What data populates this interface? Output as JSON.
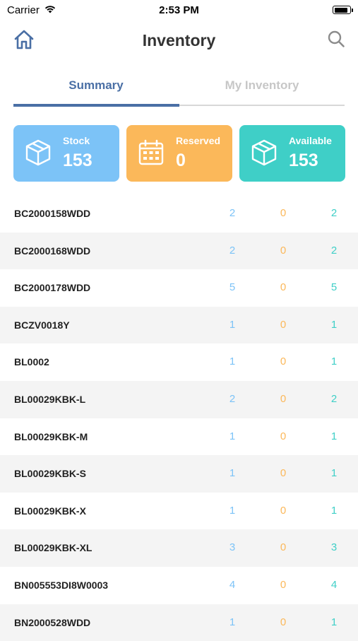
{
  "status_bar": {
    "carrier": "Carrier",
    "time": "2:53 PM",
    "battery_level": 0.9
  },
  "header": {
    "title": "Inventory",
    "left_icon": "home-icon",
    "right_icon": "search-icon"
  },
  "tabs": [
    {
      "label": "Summary",
      "active": true
    },
    {
      "label": "My Inventory",
      "active": false
    }
  ],
  "summary_cards": [
    {
      "label": "Stock",
      "value": "153",
      "icon": "box-icon",
      "color": "#7cc3f7"
    },
    {
      "label": "Reserved",
      "value": "0",
      "icon": "calendar-icon",
      "color": "#fbb85a"
    },
    {
      "label": "Available",
      "value": "153",
      "icon": "box-icon",
      "color": "#3fcfc7"
    }
  ],
  "items": [
    {
      "sku": "BC2000158WDD",
      "stock": "2",
      "reserved": "0",
      "available": "2"
    },
    {
      "sku": "BC2000168WDD",
      "stock": "2",
      "reserved": "0",
      "available": "2"
    },
    {
      "sku": "BC2000178WDD",
      "stock": "5",
      "reserved": "0",
      "available": "5"
    },
    {
      "sku": "BCZV0018Y",
      "stock": "1",
      "reserved": "0",
      "available": "1"
    },
    {
      "sku": "BL0002",
      "stock": "1",
      "reserved": "0",
      "available": "1"
    },
    {
      "sku": "BL00029KBK-L",
      "stock": "2",
      "reserved": "0",
      "available": "2"
    },
    {
      "sku": "BL00029KBK-M",
      "stock": "1",
      "reserved": "0",
      "available": "1"
    },
    {
      "sku": "BL00029KBK-S",
      "stock": "1",
      "reserved": "0",
      "available": "1"
    },
    {
      "sku": "BL00029KBK-X",
      "stock": "1",
      "reserved": "0",
      "available": "1"
    },
    {
      "sku": "BL00029KBK-XL",
      "stock": "3",
      "reserved": "0",
      "available": "3"
    },
    {
      "sku": "BN005553DI8W0003",
      "stock": "4",
      "reserved": "0",
      "available": "4"
    },
    {
      "sku": "BN2000528WDD",
      "stock": "1",
      "reserved": "0",
      "available": "1"
    }
  ]
}
